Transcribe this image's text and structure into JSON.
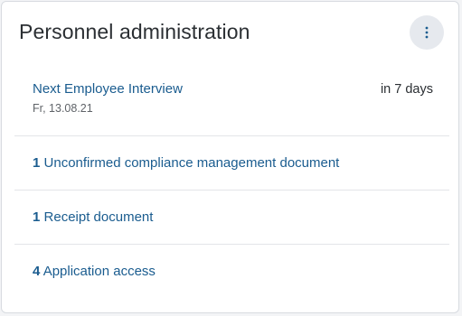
{
  "card": {
    "title": "Personnel administration",
    "menu_icon": "vertical-dots-icon",
    "accent_color": "#1a5c8f"
  },
  "items": [
    {
      "label": "Next Employee Interview",
      "date": "Fr, 13.08.21",
      "due": "in 7 days"
    },
    {
      "count": "1",
      "label": "Unconfirmed compliance management document"
    },
    {
      "count": "1",
      "label": "Receipt document"
    },
    {
      "count": "4",
      "label": "Application access"
    }
  ]
}
